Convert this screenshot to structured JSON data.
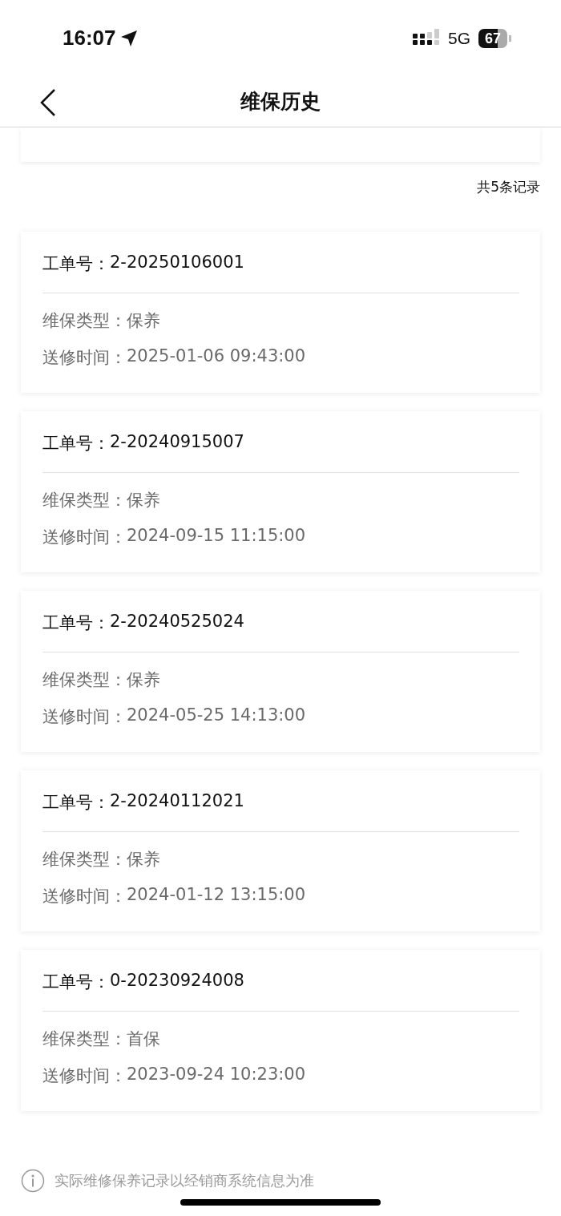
{
  "status_bar": {
    "time": "16:07",
    "network": "5G",
    "battery": "67"
  },
  "nav": {
    "title": "维保历史"
  },
  "count": "共5条记录",
  "records": [
    {
      "order_label": "工单号：",
      "order_no": "2-20250106001",
      "type_label": "维保类型：",
      "type": "保养",
      "time_label": "送修时间：",
      "time": "2025-01-06 09:43:00"
    },
    {
      "order_label": "工单号：",
      "order_no": "2-20240915007",
      "type_label": "维保类型：",
      "type": "保养",
      "time_label": "送修时间：",
      "time": "2024-09-15 11:15:00"
    },
    {
      "order_label": "工单号：",
      "order_no": "2-20240525024",
      "type_label": "维保类型：",
      "type": "保养",
      "time_label": "送修时间：",
      "time": "2024-05-25 14:13:00"
    },
    {
      "order_label": "工单号：",
      "order_no": "2-20240112021",
      "type_label": "维保类型：",
      "type": "保养",
      "time_label": "送修时间：",
      "time": "2024-01-12 13:15:00"
    },
    {
      "order_label": "工单号：",
      "order_no": "0-20230924008",
      "type_label": "维保类型：",
      "type": "首保",
      "time_label": "送修时间：",
      "time": "2023-09-24 10:23:00"
    }
  ],
  "footer_note": "实际维修保养记录以经销商系统信息为准"
}
